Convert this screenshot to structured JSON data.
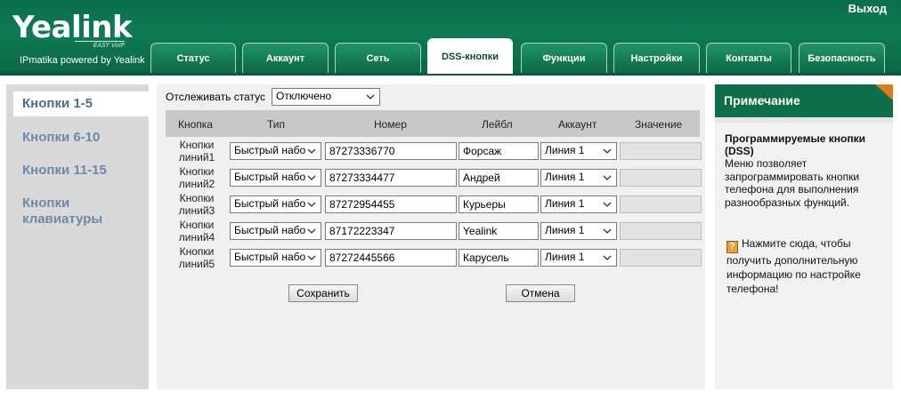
{
  "header": {
    "logo_text": "Yealink",
    "logo_sub": "EASY VoIP",
    "powered_by": "IPmatika powered by Yealink",
    "logout": "Выход"
  },
  "tabs": [
    {
      "label": "Статус",
      "active": false
    },
    {
      "label": "Аккаунт",
      "active": false
    },
    {
      "label": "Сеть",
      "active": false
    },
    {
      "label": "DSS-кнопки",
      "active": true
    },
    {
      "label": "Функции",
      "active": false
    },
    {
      "label": "Настройки",
      "active": false
    },
    {
      "label": "Контакты",
      "active": false
    },
    {
      "label": "Безопасность",
      "active": false
    }
  ],
  "sidebar": {
    "items": [
      {
        "label": "Кнопки 1-5",
        "active": true
      },
      {
        "label": "Кнопки 6-10",
        "active": false
      },
      {
        "label": "Кнопки 11-15",
        "active": false
      },
      {
        "label_line1": "Кнопки",
        "label_line2": "клавиатуры",
        "active": false
      }
    ]
  },
  "monitor": {
    "label": "Отслеживать статус",
    "value": "Отключено"
  },
  "table": {
    "headers": [
      "Кнопка",
      "Тип",
      "Номер",
      "Лейбл",
      "Аккаунт",
      "Значение"
    ],
    "rows": [
      {
        "line1": "Кнопки",
        "line2": "линий1",
        "type": "Быстрый набо",
        "number": "87273336770",
        "label": "Форсаж",
        "account": "Линия 1",
        "value": ""
      },
      {
        "line1": "Кнопки",
        "line2": "линий2",
        "type": "Быстрый набо",
        "number": "87273334477",
        "label": "Андрей",
        "account": "Линия 1",
        "value": ""
      },
      {
        "line1": "Кнопки",
        "line2": "линий3",
        "type": "Быстрый набо",
        "number": "87272954455",
        "label": "Курьеры",
        "account": "Линия 1",
        "value": ""
      },
      {
        "line1": "Кнопки",
        "line2": "линий4",
        "type": "Быстрый набо",
        "number": "87172223347",
        "label": "Yealink",
        "account": "Линия 1",
        "value": ""
      },
      {
        "line1": "Кнопки",
        "line2": "линий5",
        "type": "Быстрый набо",
        "number": "87272445566",
        "label": "Карусель",
        "account": "Линия 1",
        "value": ""
      }
    ]
  },
  "actions": {
    "save": "Сохранить",
    "cancel": "Отмена"
  },
  "note": {
    "heading": "Примечание",
    "title": "Программируемые кнопки (DSS)",
    "text": "Меню позволяет запрограммировать кнопки телефона для выполнения разнообразных функций.",
    "help_icon": "?",
    "help_text": "Нажмите сюда, чтобы получить дополнительную информацию по настройке телефона!"
  },
  "colors": {
    "brand_green": "#0e7a53",
    "note_corner": "#e07b1c",
    "nav_text": "#6a8aa8"
  }
}
